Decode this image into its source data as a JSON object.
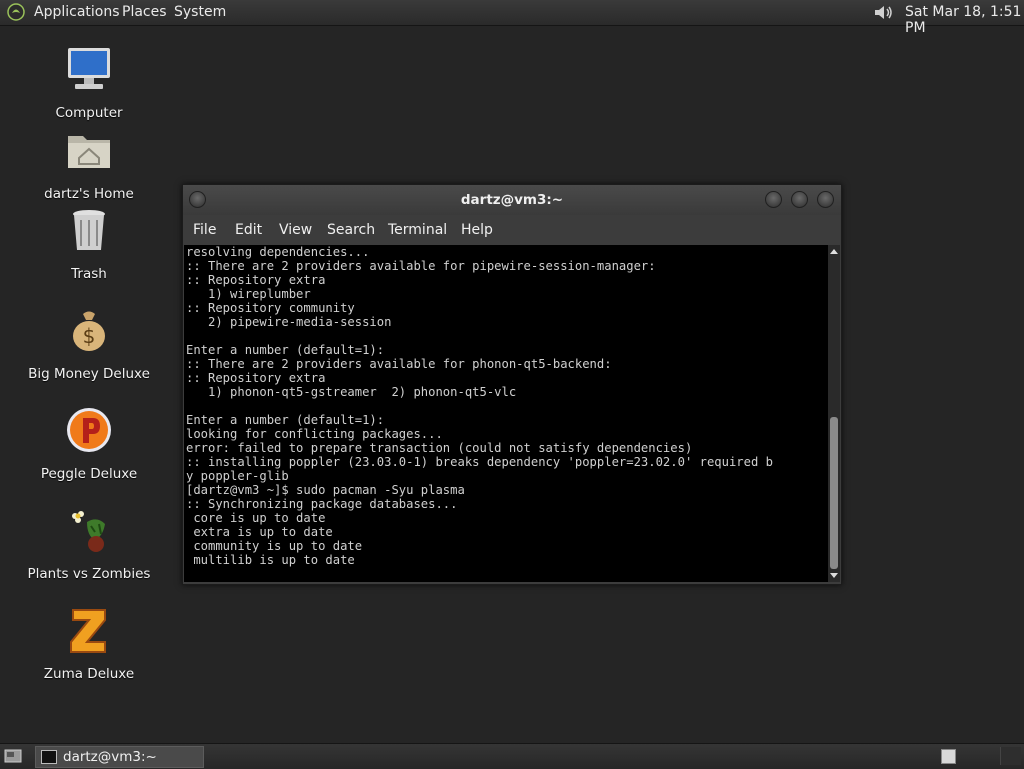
{
  "top_panel": {
    "menus": [
      "Applications",
      "Places",
      "System"
    ],
    "clock": "Sat Mar 18,  1:51 PM",
    "icons": {
      "logo": "gnome-foot-icon",
      "volume": "volume-icon"
    }
  },
  "desktop": {
    "icons": [
      {
        "label": "Computer",
        "icon": "computer-icon"
      },
      {
        "label": "dartz's Home",
        "icon": "home-folder-icon"
      },
      {
        "label": "Trash",
        "icon": "trash-icon"
      },
      {
        "label": "Big Money Deluxe",
        "icon": "money-bag-icon"
      },
      {
        "label": "Peggle Deluxe",
        "icon": "peggle-icon"
      },
      {
        "label": "Plants vs Zombies",
        "icon": "flower-icon"
      },
      {
        "label": "Zuma Deluxe",
        "icon": "zuma-icon"
      }
    ]
  },
  "terminal": {
    "title": "dartz@vm3:~",
    "menu": [
      "File",
      "Edit",
      "View",
      "Search",
      "Terminal",
      "Help"
    ],
    "lines": [
      "resolving dependencies...",
      ":: There are 2 providers available for pipewire-session-manager:",
      ":: Repository extra",
      "   1) wireplumber",
      ":: Repository community",
      "   2) pipewire-media-session",
      "",
      "Enter a number (default=1):",
      ":: There are 2 providers available for phonon-qt5-backend:",
      ":: Repository extra",
      "   1) phonon-qt5-gstreamer  2) phonon-qt5-vlc",
      "",
      "Enter a number (default=1):",
      "looking for conflicting packages...",
      "error: failed to prepare transaction (could not satisfy dependencies)",
      ":: installing poppler (23.03.0-1) breaks dependency 'poppler=23.02.0' required b",
      "y poppler-glib",
      "[dartz@vm3 ~]$ sudo pacman -Syu plasma",
      ":: Synchronizing package databases...",
      " core is up to date",
      " extra is up to date",
      " community is up to date",
      " multilib is up to date"
    ],
    "scroll_position": 0.55
  },
  "bottom_panel": {
    "task_label": "dartz@vm3:~",
    "icons": {
      "show_desktop": "show-desktop-icon",
      "task": "terminal-icon"
    }
  },
  "colors": {
    "desktop_bg": "#252525",
    "terminal_bg": "#000000",
    "terminal_fg": "#d0d0d0"
  }
}
